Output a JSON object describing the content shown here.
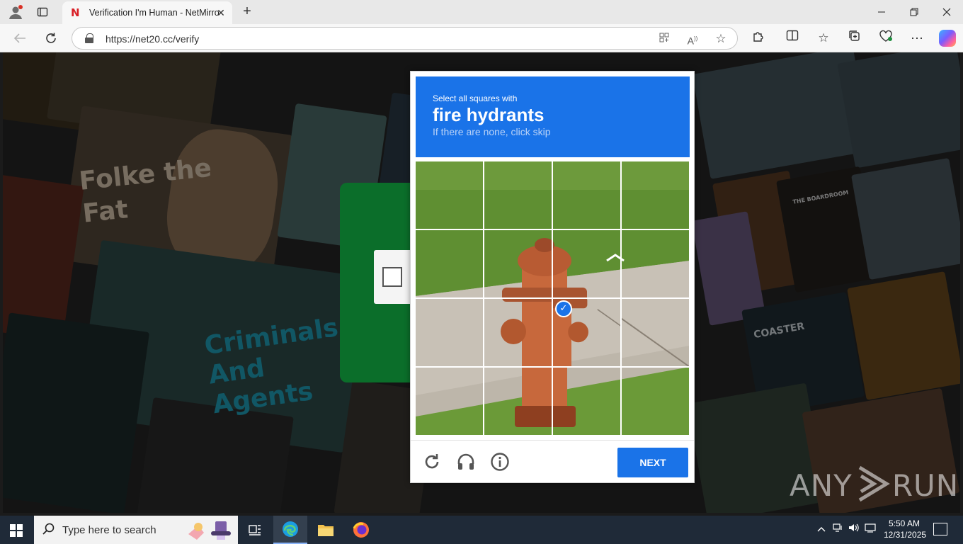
{
  "browser": {
    "tab_title": "Verification I'm Human - NetMirror",
    "tab_favicon_letter": "N",
    "url": "https://net20.cc/verify",
    "icons": [
      "profile-icon",
      "tab-actions-icon",
      "close-icon",
      "new-tab-icon",
      "minimize-icon",
      "restore-icon",
      "window-close-icon",
      "back-icon",
      "refresh-icon",
      "lock-icon",
      "apps-icon",
      "read-aloud-icon",
      "favorite-star-icon",
      "extensions-icon",
      "split-screen-icon",
      "favorites-icon",
      "collections-icon",
      "browser-essentials-icon",
      "more-icon",
      "copilot-icon"
    ]
  },
  "page": {
    "bg_text_1": "Folke the Fat",
    "bg_text_2": "Criminals And Agents",
    "bg_text_3": "COASTER",
    "bg_text_4": "THE BOARDROOM",
    "watermark": "ANY RUN",
    "green": "#0b6e2a"
  },
  "captcha": {
    "instruction": "Select all squares with",
    "object": "fire hydrants",
    "subtext": "If there are none, click skip",
    "next_label": "NEXT",
    "selected_tiles": [
      10
    ],
    "accent": "#1a73e8",
    "footer_icons": [
      "refresh-icon",
      "audio-challenge-icon",
      "info-icon"
    ]
  },
  "taskbar": {
    "search_placeholder": "Type here to search",
    "time": "5:50 AM",
    "date": "12/31/2025",
    "apps": [
      "task-view-icon",
      "edge-icon",
      "file-explorer-icon",
      "firefox-icon"
    ],
    "tray": [
      "chevron-up-icon",
      "network-icon",
      "volume-icon",
      "ime-icon",
      "notification-icon"
    ]
  }
}
